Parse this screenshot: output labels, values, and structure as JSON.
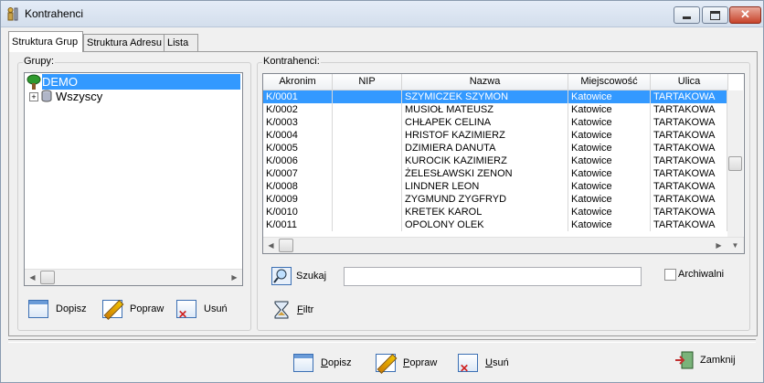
{
  "window": {
    "title": "Kontrahenci"
  },
  "tabs": [
    "Struktura Grup",
    "Struktura Adresu",
    "Lista"
  ],
  "groups_panel": {
    "label": "Grupy:",
    "tree": [
      {
        "label": "DEMO",
        "selected": true
      },
      {
        "label": "Wszyscy",
        "expand": "+"
      }
    ]
  },
  "contractors_panel": {
    "label": "Kontrahenci:",
    "columns": [
      "Akronim",
      "NIP",
      "Nazwa",
      "Miejscowość",
      "Ulica"
    ],
    "rows": [
      [
        "K/0001",
        "",
        "SZYMICZEK SZYMON",
        "Katowice",
        "TARTAKOWA"
      ],
      [
        "K/0002",
        "",
        "MUSIOŁ MATEUSZ",
        "Katowice",
        "TARTAKOWA"
      ],
      [
        "K/0003",
        "",
        "CHŁAPEK CELINA",
        "Katowice",
        "TARTAKOWA"
      ],
      [
        "K/0004",
        "",
        "HRISTOF KAZIMIERZ",
        "Katowice",
        "TARTAKOWA"
      ],
      [
        "K/0005",
        "",
        "DZIMIERA DANUTA",
        "Katowice",
        "TARTAKOWA"
      ],
      [
        "K/0006",
        "",
        "KUROCIK KAZIMIERZ",
        "Katowice",
        "TARTAKOWA"
      ],
      [
        "K/0007",
        "",
        "ŻELESŁAWSKI ZENON",
        "Katowice",
        "TARTAKOWA"
      ],
      [
        "K/0008",
        "",
        "LINDNER LEON",
        "Katowice",
        "TARTAKOWA"
      ],
      [
        "K/0009",
        "",
        "ZYGMUND ZYGFRYD",
        "Katowice",
        "TARTAKOWA"
      ],
      [
        "K/0010",
        "",
        "KRETEK KAROL",
        "Katowice",
        "TARTAKOWA"
      ],
      [
        "K/0011",
        "",
        "OPOLONY  OLEK",
        "Katowice",
        "TARTAKOWA"
      ]
    ],
    "selected_row": 0
  },
  "search": {
    "label": "Szukaj",
    "value": "",
    "filter_label_first": "F",
    "filter_label_rest": "iltr",
    "archive_label": "Archiwalni"
  },
  "group_buttons": {
    "add": "Dopisz",
    "edit": "Popraw",
    "delete": "Usuń"
  },
  "bottom_buttons": {
    "add_first": "D",
    "add_rest": "opisz",
    "edit_first": "P",
    "edit_rest": "opraw",
    "delete_first": "U",
    "delete_rest": "suń",
    "close_rest": "Zamkni",
    "close_last": "j"
  },
  "colors": {
    "selection": "#3399ff",
    "titlebar": "#dbe5f1",
    "close": "#c7432a"
  }
}
